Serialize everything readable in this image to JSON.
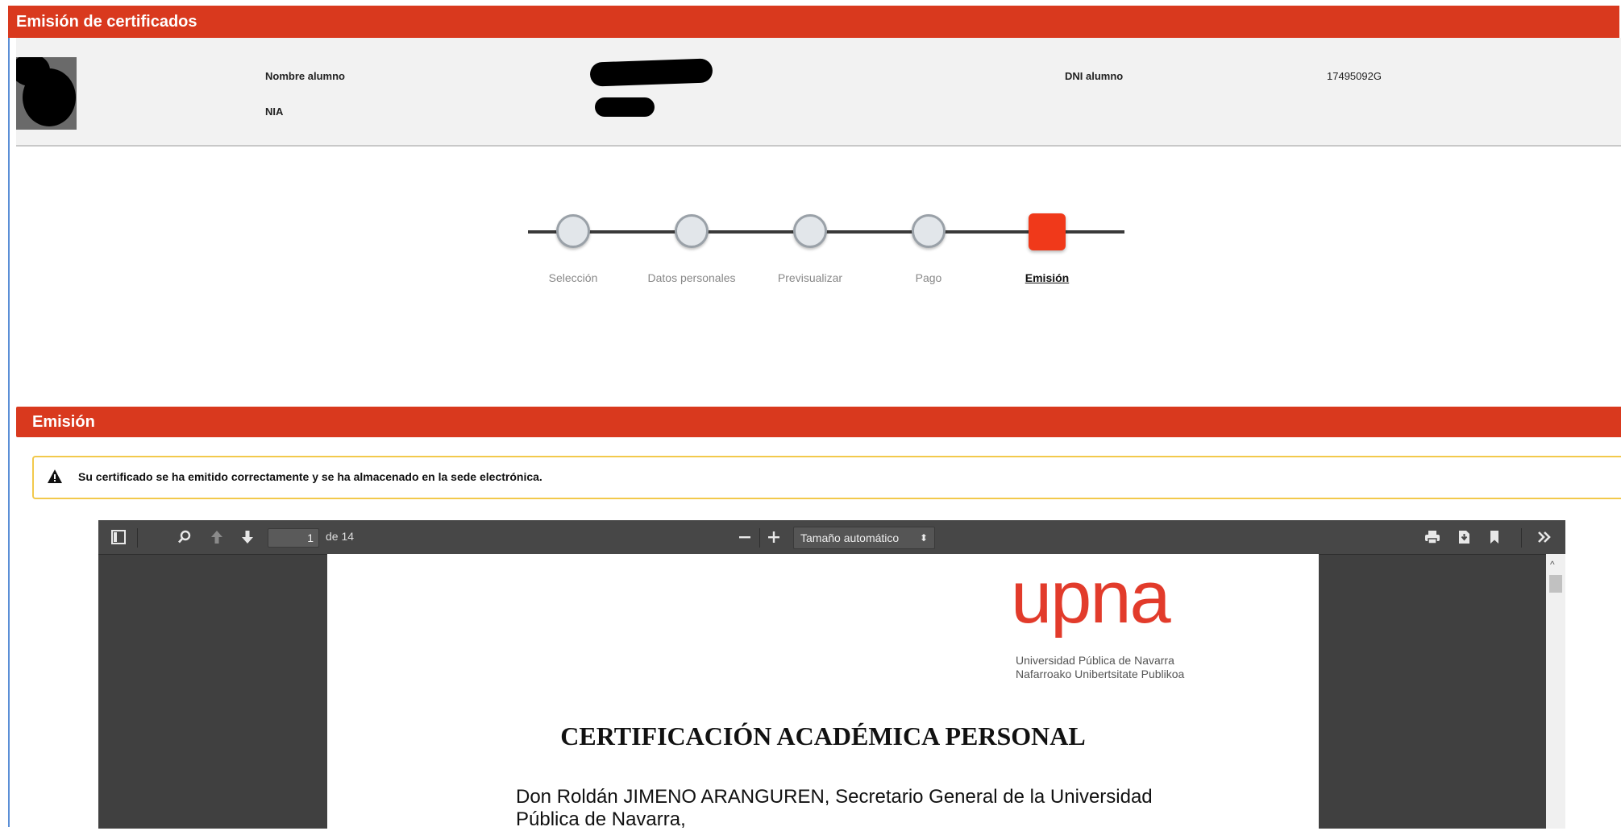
{
  "header": {
    "title": "Emisión de certificados"
  },
  "student": {
    "name_label": "Nombre alumno",
    "nia_label": "NIA",
    "dni_label": "DNI alumno",
    "dni_value": "17495092G"
  },
  "stepper": {
    "steps": [
      {
        "label": "Selección",
        "state": "done"
      },
      {
        "label": "Datos personales",
        "state": "done"
      },
      {
        "label": "Previsualizar",
        "state": "done"
      },
      {
        "label": "Pago",
        "state": "done"
      },
      {
        "label": "Emisión",
        "state": "current"
      }
    ]
  },
  "section": {
    "title": "Emisión"
  },
  "alert": {
    "message": "Su certificado se ha emitido correctamente y se ha almacenado en la sede electrónica."
  },
  "pdf_viewer": {
    "page_current": "1",
    "page_total_text": "de 14",
    "zoom_label": "Tamaño automático",
    "icons": [
      "sidebar-toggle-icon",
      "search-icon",
      "previous-page-icon",
      "next-page-icon",
      "zoom-out-icon",
      "zoom-in-icon",
      "print-icon",
      "download-icon",
      "bookmark-icon",
      "tools-icon"
    ]
  },
  "document": {
    "logo_text": "upna",
    "logo_line1": "Universidad Pública de Navarra",
    "logo_line2": "Nafarroako Unibertsitate Publikoa",
    "title": "CERTIFICACIÓN ACADÉMICA PERSONAL",
    "body_line1": "Don Roldán JIMENO ARANGUREN, Secretario General de la Universidad",
    "body_line2": "Pública de Navarra,"
  },
  "colors": {
    "accent": "#d9391e",
    "active_step": "#f0391a",
    "alert_border": "#f2c94c",
    "viewer_bg": "#404040"
  }
}
